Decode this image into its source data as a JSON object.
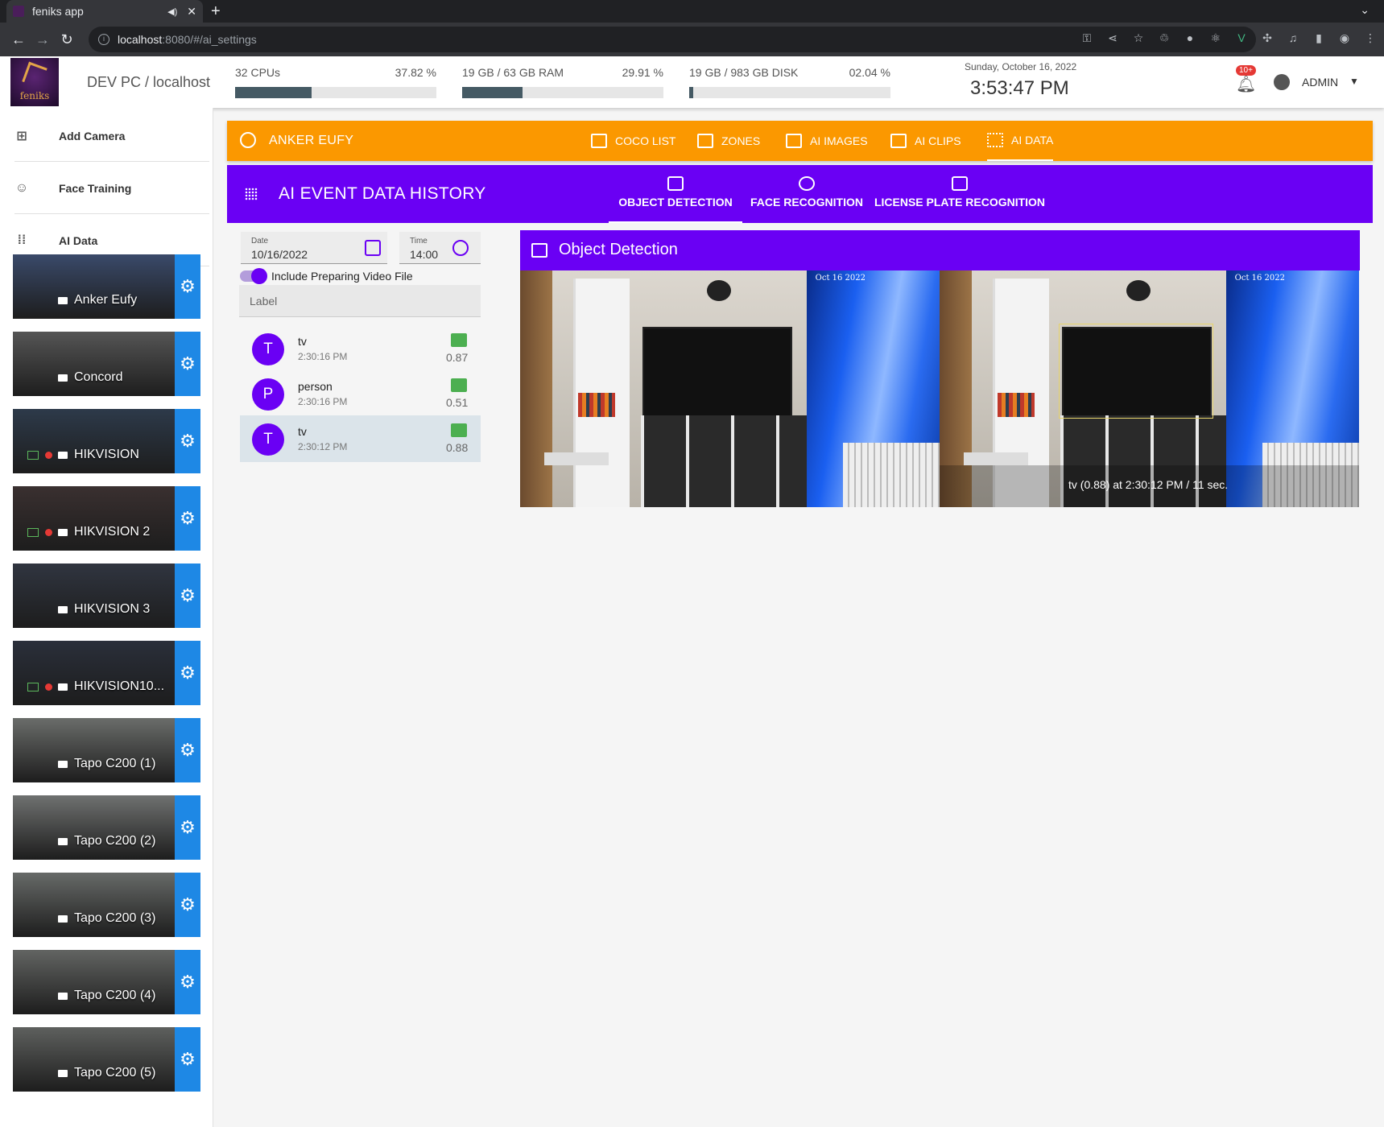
{
  "browser": {
    "tab_title": "feniks app",
    "url_host": "localhost",
    "url_path": ":8080/#/ai_settings"
  },
  "header": {
    "host": "DEV PC / localhost",
    "stats": [
      {
        "label": "32 CPUs",
        "percent": "37.82 %",
        "fill": 0.3782
      },
      {
        "label": "19 GB / 63 GB RAM",
        "percent": "29.91 %",
        "fill": 0.2991
      },
      {
        "label": "19 GB / 983 GB DISK",
        "percent": "02.04 %",
        "fill": 0.0204
      }
    ],
    "date": "Sunday, October 16, 2022",
    "time": "3:53:47 PM",
    "notification_badge": "10+",
    "user": "ADMIN",
    "logo_text": "feniks"
  },
  "sidebar": {
    "menu": [
      {
        "label": "Add Camera",
        "icon": "plus-box-icon"
      },
      {
        "label": "Face Training",
        "icon": "face-icon"
      },
      {
        "label": "AI Data",
        "icon": "dots-grid-icon"
      }
    ],
    "cameras": [
      {
        "name": "Anker Eufy",
        "recording": false,
        "playback": false
      },
      {
        "name": "Concord",
        "recording": false,
        "playback": false
      },
      {
        "name": "HIKVISION",
        "recording": true,
        "playback": true
      },
      {
        "name": "HIKVISION 2",
        "recording": true,
        "playback": true
      },
      {
        "name": "HIKVISION 3",
        "recording": false,
        "playback": false
      },
      {
        "name": "HIKVISION10...",
        "recording": true,
        "playback": true
      },
      {
        "name": "Tapo C200 (1)",
        "recording": false,
        "playback": false
      },
      {
        "name": "Tapo C200 (2)",
        "recording": false,
        "playback": false
      },
      {
        "name": "Tapo C200 (3)",
        "recording": false,
        "playback": false
      },
      {
        "name": "Tapo C200 (4)",
        "recording": false,
        "playback": false
      },
      {
        "name": "Tapo C200 (5)",
        "recording": false,
        "playback": false
      }
    ]
  },
  "camera_toolbar": {
    "title": "ANKER EUFY",
    "tabs": [
      "COCO LIST",
      "ZONES",
      "AI IMAGES",
      "AI CLIPS",
      "AI DATA"
    ],
    "active_tab": "AI DATA"
  },
  "history": {
    "title": "AI EVENT DATA HISTORY",
    "tabs": [
      "OBJECT DETECTION",
      "FACE RECOGNITION",
      "LICENSE PLATE RECOGNITION"
    ],
    "active_tab": "OBJECT DETECTION"
  },
  "filters": {
    "date_label": "Date",
    "date_value": "10/16/2022",
    "time_label": "Time",
    "time_value": "14:00",
    "include_preparing_label": "Include Preparing Video File",
    "include_preparing": true,
    "label_placeholder": "Label"
  },
  "events": [
    {
      "avatar": "T",
      "label": "tv",
      "time": "2:30:16 PM",
      "score": "0.87"
    },
    {
      "avatar": "P",
      "label": "person",
      "time": "2:30:16 PM",
      "score": "0.51"
    },
    {
      "avatar": "T",
      "label": "tv",
      "time": "2:30:12 PM",
      "score": "0.88",
      "selected": true
    }
  ],
  "detection": {
    "title": "Object Detection",
    "timestamp": "Oct 16 2022",
    "caption": "tv (0.88) at 2:30:12 PM / 11 sec."
  },
  "colors": {
    "orange": "#fb9800",
    "purple": "#6a00f4",
    "gear_blue": "#1e88e5",
    "score_green": "#4caf50"
  }
}
